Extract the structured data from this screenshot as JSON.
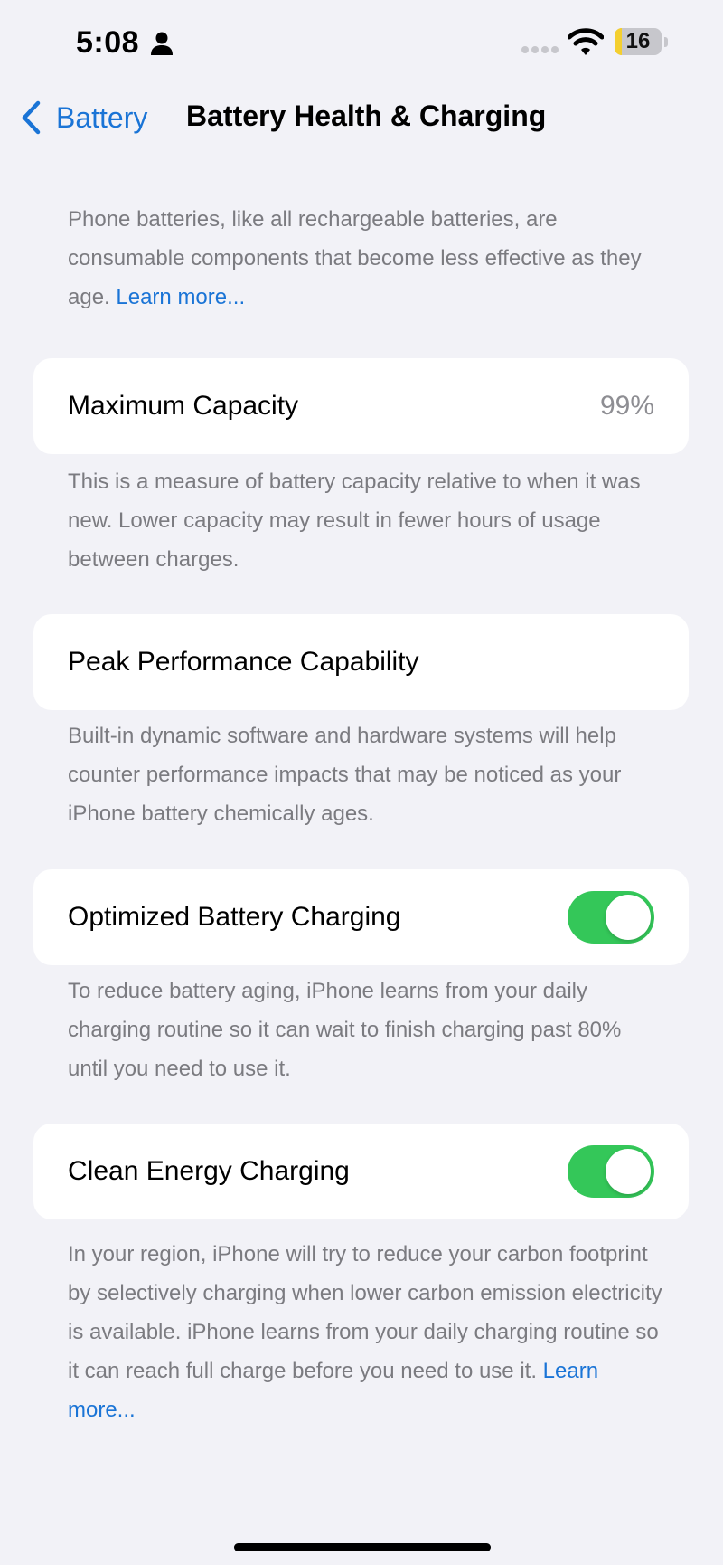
{
  "status_bar": {
    "time": "5:08",
    "battery_level": "16",
    "battery_fraction": 0.16,
    "battery_color": "#f4cf2f",
    "icons": [
      "person-icon",
      "signal-dots-icon",
      "wifi-icon",
      "battery-icon"
    ]
  },
  "nav": {
    "back_label": "Battery",
    "title": "Battery Health & Charging",
    "back_icon": "chevron-left-icon"
  },
  "intro": {
    "text": "Phone batteries, like all rechargeable batteries, are consumable components that become less effective as they age. ",
    "link": "Learn more..."
  },
  "sections": {
    "max_capacity": {
      "label": "Maximum Capacity",
      "value": "99%",
      "footer": "This is a measure of battery capacity relative to when it was new. Lower capacity may result in fewer hours of usage between charges."
    },
    "peak_performance": {
      "label": "Peak Performance Capability",
      "footer": "Built-in dynamic software and hardware systems will help counter performance impacts that may be noticed as your iPhone battery chemically ages."
    },
    "optimized_charging": {
      "label": "Optimized Battery Charging",
      "enabled": true,
      "footer": "To reduce battery aging, iPhone learns from your daily charging routine so it can wait to finish charging past 80% until you need to use it."
    },
    "clean_energy": {
      "label": "Clean Energy Charging",
      "enabled": true,
      "footer": "In your region, iPhone will try to reduce your carbon footprint by selectively charging when lower carbon emission electricity is available. iPhone learns from your daily charging routine so it can reach full charge before you need to use it. ",
      "footer_link": "Learn more..."
    }
  },
  "colors": {
    "accent": "#1a74d6",
    "toggle_on": "#34c759",
    "background": "#f2f2f7",
    "secondary_text": "#7b7b80"
  }
}
